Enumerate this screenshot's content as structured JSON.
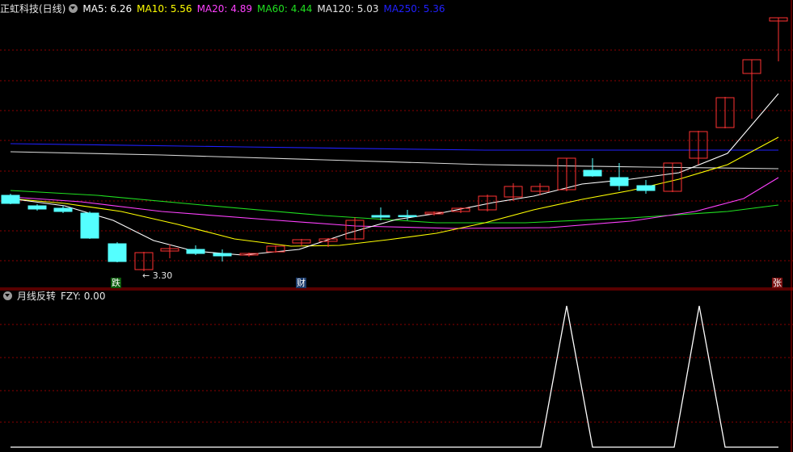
{
  "top_legend": {
    "stock": "正虹科技(日线)",
    "ma": [
      {
        "label": "MA5: 6.26",
        "color": "#ffffff"
      },
      {
        "label": "MA10: 5.56",
        "color": "#ffff00"
      },
      {
        "label": "MA20: 4.89",
        "color": "#ff40ff"
      },
      {
        "label": "MA60: 4.44",
        "color": "#20e020"
      },
      {
        "label": "MA120: 5.03",
        "color": "#e6e6e6"
      },
      {
        "label": "MA250: 5.36",
        "color": "#2020ff"
      }
    ]
  },
  "bottom_legend": {
    "indicator": "月线反转",
    "value": "FZY: 0.00"
  },
  "markers": {
    "low_price": "3.30",
    "tag_die": "跌",
    "tag_cai": "财",
    "tag_zhang": "张"
  },
  "colors": {
    "up": "#ff3232",
    "down": "#54ffff",
    "grid": "#8b0000"
  }
}
